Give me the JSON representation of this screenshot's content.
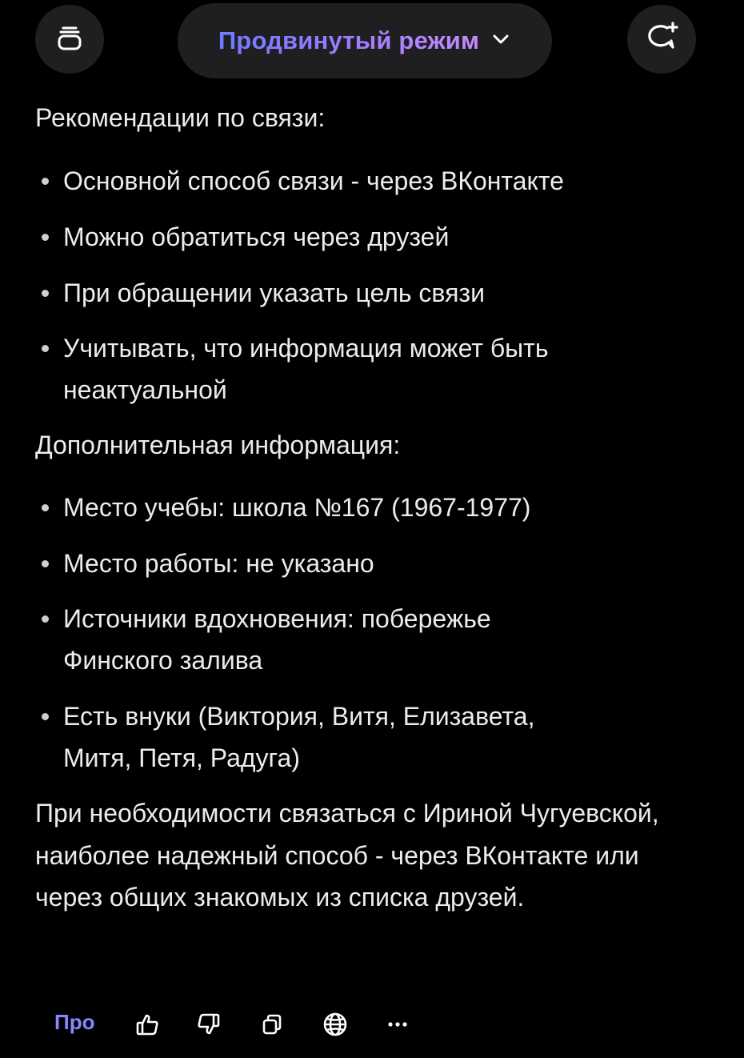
{
  "header": {
    "mode_label": "Продвинутый режим"
  },
  "sections": {
    "recommendations_heading": "Рекомендации по связи:",
    "recommendations": [
      "Основной способ связи - через ВКонтакте",
      "Можно обратиться через друзей",
      "При обращении указать цель связи",
      "Учитывать, что информация может быть неактуальной"
    ],
    "additional_heading": "Дополнительная информация:",
    "additional": [
      "Место учебы: школа №167 (1967-1977)",
      "Место работы: не указано",
      "Источники вдохновения: побережье Финского залива",
      "Есть внуки (Виктория, Витя, Елизавета, Митя, Петя, Радуга)"
    ],
    "conclusion": "При необходимости связаться с Ириной Чугуевской, наиболее надежный способ - через ВКонтакте или через общих знакомых из списка друзей."
  },
  "actions": {
    "pro_label": "Про"
  },
  "colors": {
    "background": "#000000",
    "surface": "#1f1f22",
    "text": "#ececec",
    "accent": "#8a86ff"
  },
  "icons": [
    "stack-icon",
    "chevron-down-icon",
    "new-chat-icon",
    "thumbs-up-icon",
    "thumbs-down-icon",
    "copy-icon",
    "globe-icon",
    "more-icon"
  ]
}
